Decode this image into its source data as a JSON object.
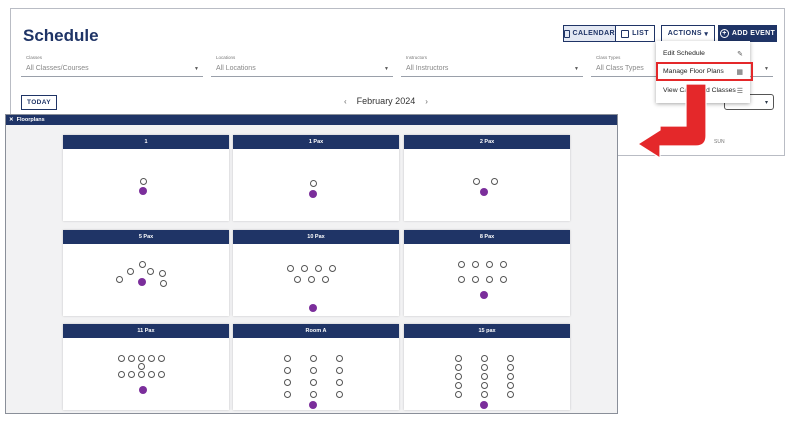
{
  "schedule": {
    "title": "Schedule",
    "calendar_label": "CALENDAR",
    "list_label": "LIST",
    "actions_label": "ACTIONS",
    "add_event_label": "ADD EVENT",
    "filters": [
      {
        "label": "Classes",
        "value": "All Classes/Courses"
      },
      {
        "label": "Locations",
        "value": "All Locations"
      },
      {
        "label": "Instructors",
        "value": "All Instructors"
      },
      {
        "label": "Class Types",
        "value": "All Class Types"
      }
    ],
    "today_label": "TODAY",
    "month": "February 2024",
    "day_label": "SUN"
  },
  "menu": {
    "items": [
      {
        "label": "Edit Schedule",
        "icon": "pencil-icon"
      },
      {
        "label": "Manage Floor Plans",
        "icon": "grid-icon"
      },
      {
        "label": "View Cancelled Classes",
        "icon": "list-icon"
      }
    ]
  },
  "floorplans": {
    "title": "Floorplans",
    "cards": [
      {
        "name": "1"
      },
      {
        "name": "1 Pax"
      },
      {
        "name": "2 Pax"
      },
      {
        "name": "5 Pax"
      },
      {
        "name": "10 Pax"
      },
      {
        "name": "8 Pax"
      },
      {
        "name": "11 Pax"
      },
      {
        "name": "Room A"
      },
      {
        "name": "15 pax"
      }
    ]
  },
  "colors": {
    "primary": "#1f3466",
    "instructor": "#7b2e9b",
    "callout": "#e4282a"
  }
}
